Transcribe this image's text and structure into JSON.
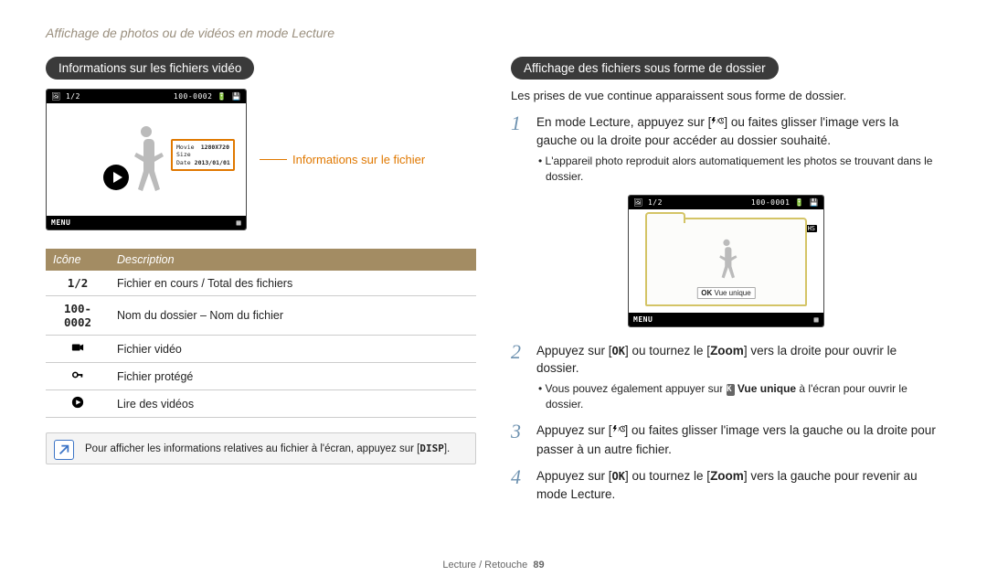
{
  "breadcrumb": "Affichage de photos ou de vidéos en mode Lecture",
  "left": {
    "heading": "Informations sur les fichiers vidéo",
    "callout": "Informations sur le fichier",
    "lcd": {
      "top_index": "1/2",
      "top_file": "100-0002",
      "menu": "MENU",
      "info_label_size": "Movie Size",
      "info_val_size": "1280X720",
      "info_label_date": "Date",
      "info_val_date": "2013/01/01"
    },
    "table": {
      "h1": "Icône",
      "h2": "Description",
      "rows": {
        "r1": {
          "icon": "1/2",
          "desc": "Fichier en cours / Total des fichiers"
        },
        "r2": {
          "icon": "100-0002",
          "desc": "Nom du dossier – Nom du fichier"
        },
        "r3": {
          "desc": "Fichier vidéo"
        },
        "r4": {
          "desc": "Fichier protégé"
        },
        "r5": {
          "desc": "Lire des vidéos"
        }
      }
    },
    "note_pre": "Pour afficher les informations relatives au fichier à l'écran, appuyez sur [",
    "note_disp": "DISP",
    "note_post": "]."
  },
  "right": {
    "heading": "Affichage des fichiers sous forme de dossier",
    "intro": "Les prises de vue continue apparaissent sous forme de dossier.",
    "step1": {
      "pre": "En mode Lecture, appuyez sur [",
      "post": "] ou faites glisser l'image vers la gauche ou la droite pour accéder au dossier souhaité.",
      "sub": "L'appareil photo reproduit alors automatiquement les photos se trouvant dans le dossier."
    },
    "lcd": {
      "top_index": "1/2",
      "top_file": "100-0001",
      "menu": "MENU",
      "hs": "HS",
      "ok": "OK",
      "vue": "Vue unique"
    },
    "step2": {
      "pre": "Appuyez sur [",
      "mid": "] ou tournez le [",
      "zoom": "Zoom",
      "post": "] vers la droite pour ouvrir le dossier.",
      "sub_pre": "Vous pouvez également appuyer sur ",
      "sub_chip": "OK",
      "sub_label": " Vue unique",
      "sub_post": " à l'écran pour ouvrir le dossier."
    },
    "step3": {
      "pre": "Appuyez sur [",
      "post": "] ou faites glisser l'image vers la gauche ou la droite pour passer à un autre fichier."
    },
    "step4": {
      "pre": "Appuyez sur [",
      "mid": "] ou tournez le [",
      "zoom": "Zoom",
      "post": "] vers la gauche pour revenir au mode Lecture."
    }
  },
  "footer": {
    "section": "Lecture / Retouche",
    "page": "89"
  }
}
